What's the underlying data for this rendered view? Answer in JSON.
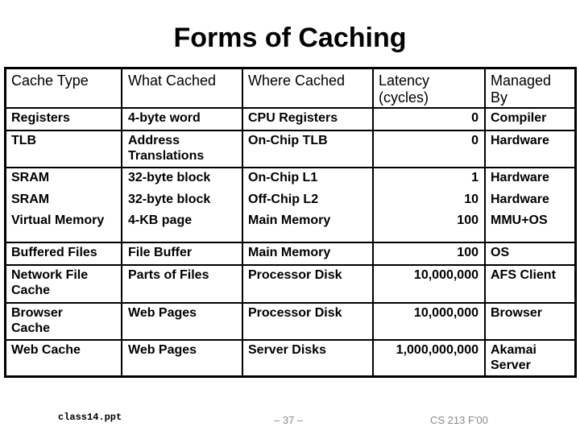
{
  "title": "Forms of Caching",
  "table": {
    "headers": [
      "Cache Type",
      "What Cached",
      "Where Cached",
      "Latency\n(cycles)",
      "Managed\nBy"
    ],
    "rows": [
      [
        "Registers",
        "4-byte word",
        "CPU Registers",
        "0",
        "Compiler"
      ],
      [
        "TLB",
        "Address\nTranslations",
        "On-Chip TLB",
        "0",
        "Hardware"
      ],
      [
        "SRAM",
        "32-byte block",
        "On-Chip L1",
        "1",
        "Hardware"
      ],
      [
        "SRAM",
        "32-byte block",
        "Off-Chip L2",
        "10",
        "Hardware"
      ],
      [
        "Virtual Memory",
        "4-KB page",
        "Main Memory",
        "100",
        "MMU+OS"
      ],
      [
        "Buffered Files",
        "File Buffer",
        "Main Memory",
        "100",
        "OS"
      ],
      [
        "Network File\nCache",
        "Parts of Files",
        "Processor Disk",
        "10,000,000",
        "AFS Client"
      ],
      [
        "Browser\nCache",
        "Web Pages",
        "Processor Disk",
        "10,000,000",
        "Browser"
      ],
      [
        "Web Cache",
        "Web Pages",
        "Server Disks",
        "1,000,000,000",
        "Akamai\nServer"
      ]
    ]
  },
  "footer": {
    "filename": "class14.ppt",
    "page": "– 37 –",
    "course": "CS 213 F'00"
  }
}
